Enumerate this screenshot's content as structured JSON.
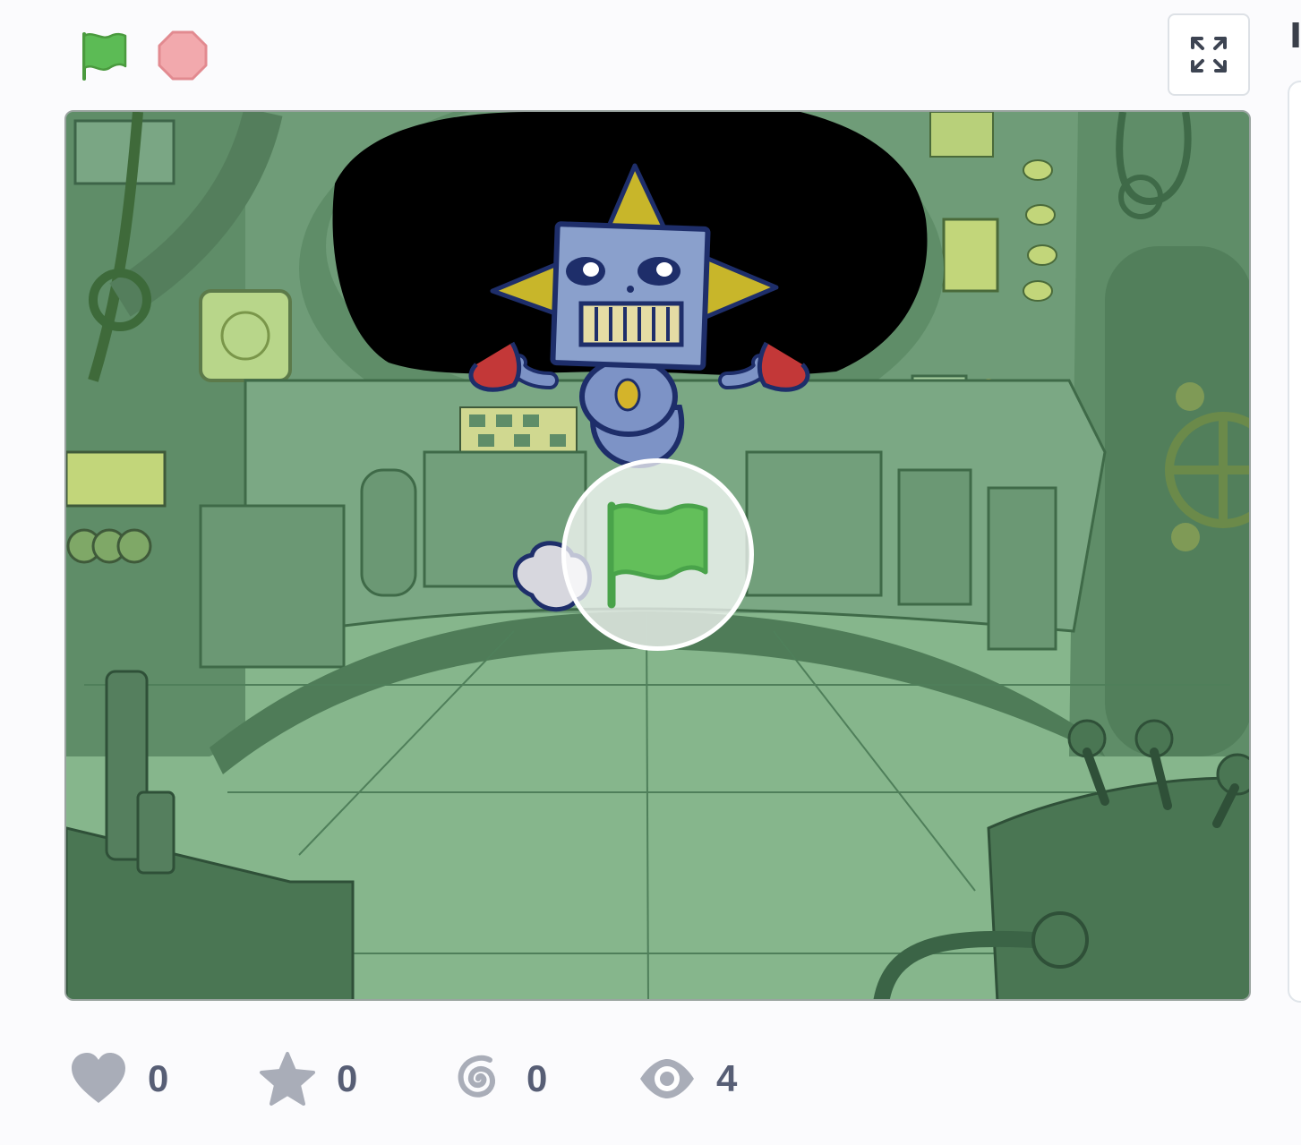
{
  "controls": {
    "green_flag_icon": "green-flag-icon",
    "stop_icon": "stop-sign-icon",
    "fullscreen_icon": "fullscreen-icon",
    "edge_text": "I"
  },
  "stage": {
    "overlay_icon": "green-flag-icon",
    "sprite": "robot"
  },
  "stats": [
    {
      "name": "loves",
      "icon": "heart-icon",
      "count": "0"
    },
    {
      "name": "favorites",
      "icon": "star-icon",
      "count": "0"
    },
    {
      "name": "remixes",
      "icon": "remix-icon",
      "count": "0"
    },
    {
      "name": "views",
      "icon": "eye-icon",
      "count": "4"
    }
  ],
  "colors": {
    "flag_green": "#5cb85c",
    "stop_red": "#f0a8ab",
    "stat_icon_gray": "#a9adb8",
    "stat_text": "#575e75",
    "stage_bg": "#87b48c"
  }
}
